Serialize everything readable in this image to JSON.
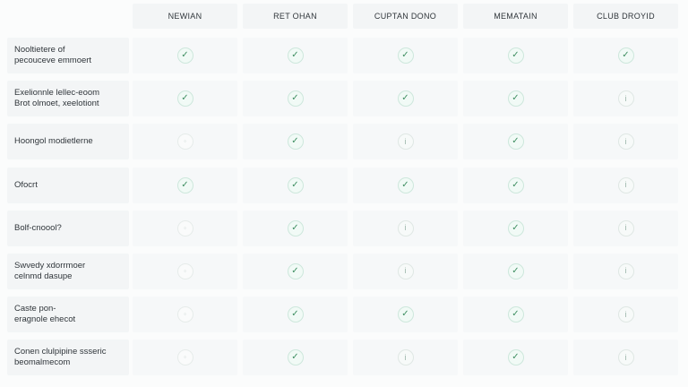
{
  "columns": [
    "NEWIAN",
    "RET OHAN",
    "CUPTAN DONO",
    "MEMATAIN",
    "CLUB DROYID"
  ],
  "icons": {
    "check": "checkmark-icon",
    "info": "info-icon",
    "dot": "empty-circle-icon"
  },
  "glyphs": {
    "check": "✓",
    "info": "i",
    "dot": "◦"
  },
  "rows": [
    {
      "label": "Nooltietere of\npecouceve emmoert",
      "cells": [
        "check",
        "check",
        "check",
        "check",
        "check"
      ]
    },
    {
      "label": "Exelionnle lellec-eoom\nBrot olmoet, xeelotiont",
      "cells": [
        "check",
        "check",
        "check",
        "check",
        "info"
      ]
    },
    {
      "label": "Hoongol modietlerne",
      "cells": [
        "dot",
        "check",
        "info",
        "check",
        "info"
      ]
    },
    {
      "label": "Ofocrt",
      "cells": [
        "check",
        "check",
        "check",
        "check",
        "info"
      ]
    },
    {
      "label": "Bolf-cnoool?",
      "cells": [
        "dot",
        "check",
        "info",
        "check",
        "info"
      ]
    },
    {
      "label": "Swvedy xdorrmoer\ncelnmd dasupe",
      "cells": [
        "dot",
        "check",
        "info",
        "check",
        "info"
      ]
    },
    {
      "label": "Caste pon-\neragnole ehecot",
      "cells": [
        "dot",
        "check",
        "check",
        "check",
        "info"
      ]
    },
    {
      "label": "Conen clulpipine ssseric\nbeomalmecom",
      "cells": [
        "dot",
        "check",
        "info",
        "check",
        "info"
      ]
    }
  ]
}
